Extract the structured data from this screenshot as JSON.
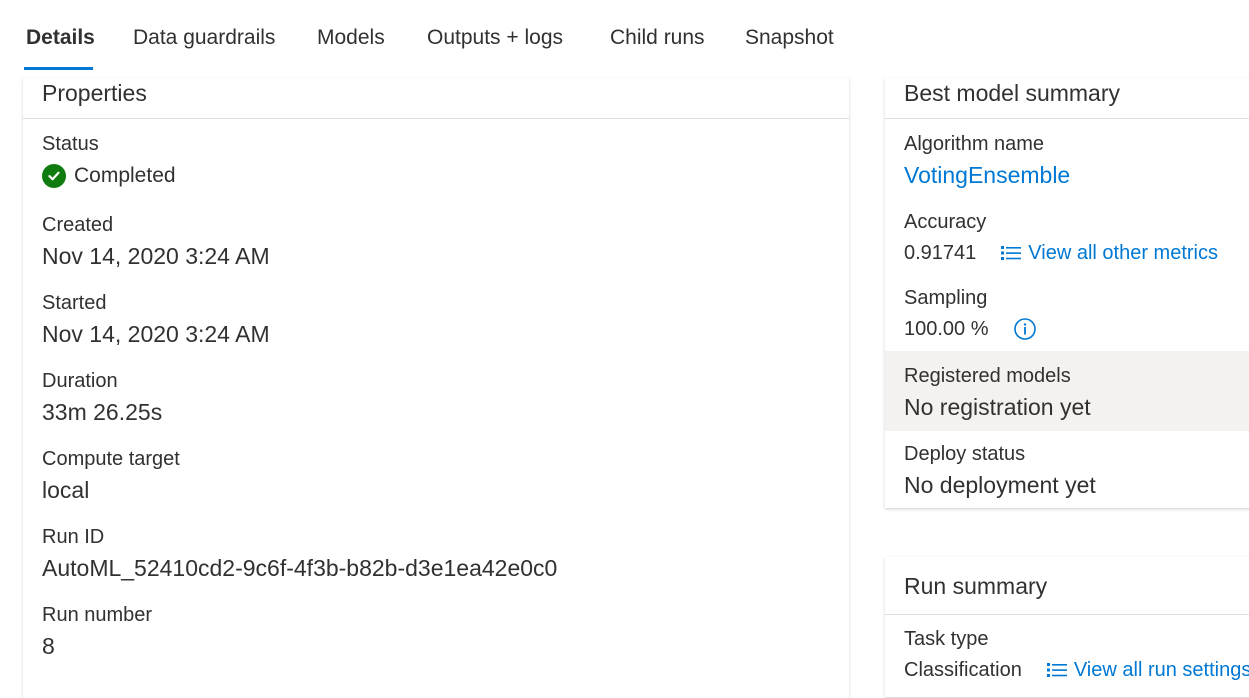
{
  "tabs": [
    {
      "label": "Details"
    },
    {
      "label": "Data guardrails"
    },
    {
      "label": "Models"
    },
    {
      "label": "Outputs + logs"
    },
    {
      "label": "Child runs"
    },
    {
      "label": "Snapshot"
    }
  ],
  "properties": {
    "title": "Properties",
    "status_label": "Status",
    "status_value": "Completed",
    "created_label": "Created",
    "created_value": "Nov 14, 2020 3:24 AM",
    "started_label": "Started",
    "started_value": "Nov 14, 2020 3:24 AM",
    "duration_label": "Duration",
    "duration_value": "33m 26.25s",
    "compute_label": "Compute target",
    "compute_value": "local",
    "runid_label": "Run ID",
    "runid_value": "AutoML_52410cd2-9c6f-4f3b-b82b-d3e1ea42e0c0",
    "runnumber_label": "Run number",
    "runnumber_value": "8"
  },
  "best_model": {
    "title": "Best model summary",
    "algorithm_label": "Algorithm name",
    "algorithm_value": "VotingEnsemble",
    "accuracy_label": "Accuracy",
    "accuracy_value": "0.91741",
    "metrics_link": "View all other metrics",
    "sampling_label": "Sampling",
    "sampling_value": "100.00 %",
    "registered_label": "Registered models",
    "registered_value": "No registration yet",
    "deploy_label": "Deploy status",
    "deploy_value": "No deployment yet"
  },
  "run_summary": {
    "title": "Run summary",
    "task_label": "Task type",
    "task_value": "Classification",
    "settings_link": "View all run settings"
  },
  "colors": {
    "accent": "#0078d4",
    "success": "#107c10",
    "highlight": "#f3f2f1"
  }
}
